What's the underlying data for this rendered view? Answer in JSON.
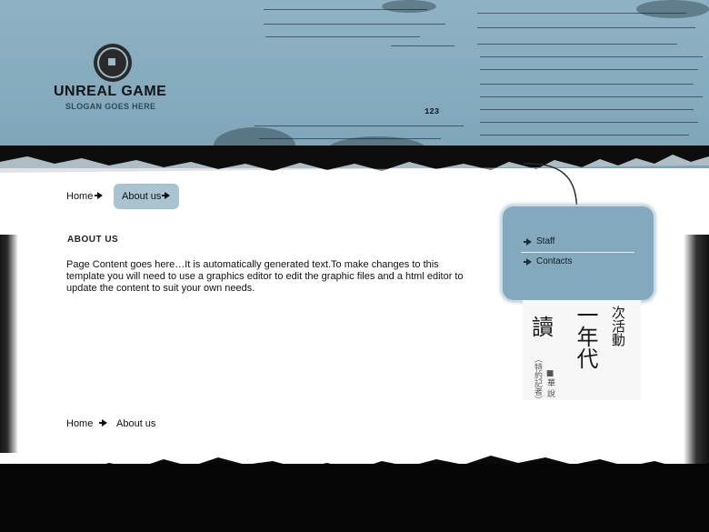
{
  "header": {
    "title": "UNREAL GAME",
    "slogan": "SLOGAN GOES HERE",
    "stamp_number": "123",
    "logo_icon": "coin-logo-icon"
  },
  "breadcrumb_top": {
    "items": [
      {
        "label": "Home",
        "icon": "arrow-right-icon"
      },
      {
        "label": "About us",
        "icon": "arrow-right-icon",
        "active": true
      }
    ]
  },
  "content": {
    "title": "ABOUT US",
    "body": "Page Content goes here…It is automatically generated text.To make changes to this template you will need to use a graphics editor to edit the graphic files and a html editor to update the content to suit your own needs."
  },
  "sidebar": {
    "menu": [
      {
        "label": "Staff",
        "icon": "arrow-right-icon"
      },
      {
        "label": "Contacts",
        "icon": "arrow-right-icon"
      }
    ],
    "image_text": {
      "col1": "次活動",
      "col2": "一年代",
      "col3": "讀",
      "small": "（特約記者）",
      "small2": "■華 說"
    }
  },
  "breadcrumb_bottom": {
    "items": [
      {
        "label": "Home",
        "icon": "arrow-right-icon"
      },
      {
        "label": "About us"
      }
    ]
  },
  "colors": {
    "header_blue": "#85aabd",
    "menu_blue": "#84a9bd",
    "active_crumb": "#a9c3d0",
    "dark": "#050505"
  }
}
